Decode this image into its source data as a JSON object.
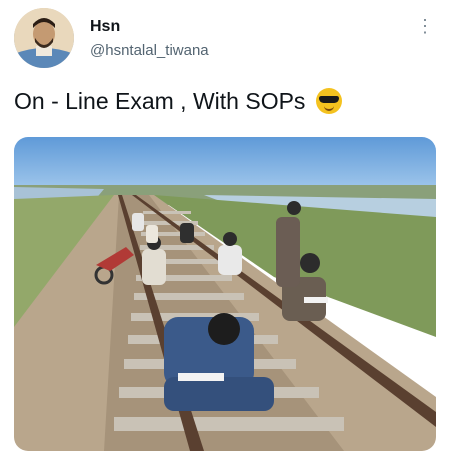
{
  "tweet": {
    "author_name": "Hsn",
    "author_handle": "@hsntalal_tiwana",
    "text": "On - Line Exam , With SOPs",
    "emoji": "smiling face with sunglasses",
    "more_icon": "more-vertical-icon",
    "media": {
      "description_icon": "photo",
      "colors": {
        "sky": "#7fb2e4",
        "ground": "#bfa98c",
        "grass": "#8fa464",
        "rail": "#5a4030"
      }
    }
  }
}
